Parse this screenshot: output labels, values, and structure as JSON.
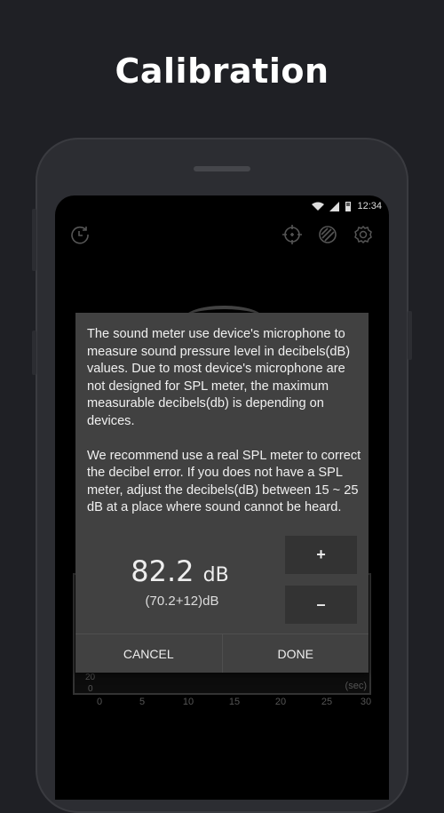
{
  "header": {
    "title": "Calibration"
  },
  "status_bar": {
    "time": "12:34"
  },
  "toolbar": {
    "icons": [
      "history-icon",
      "crosshair-icon",
      "theme-icon",
      "gear-icon"
    ]
  },
  "chart": {
    "y_labels": [
      "20",
      "0"
    ],
    "x_labels": [
      "0",
      "5",
      "10",
      "15",
      "20",
      "25",
      "30"
    ],
    "x_unit": "(sec)"
  },
  "dialog": {
    "message": "The sound meter use device's microphone to measure sound pressure level in decibels(dB) values. Due to most device's microphone are not designed for SPL meter, the maximum measurable decibels(db) is depending on devices.\n\nWe recommend use a real SPL meter to correct the decibel error. If you does not have a SPL meter, adjust the decibels(dB) between 15 ~ 25 dB at a place where sound cannot be heard.",
    "value": "82.2",
    "unit": "dB",
    "formula": "(70.2+12)dB",
    "plus_label": "+",
    "minus_label": "–",
    "cancel_label": "CANCEL",
    "done_label": "DONE"
  }
}
